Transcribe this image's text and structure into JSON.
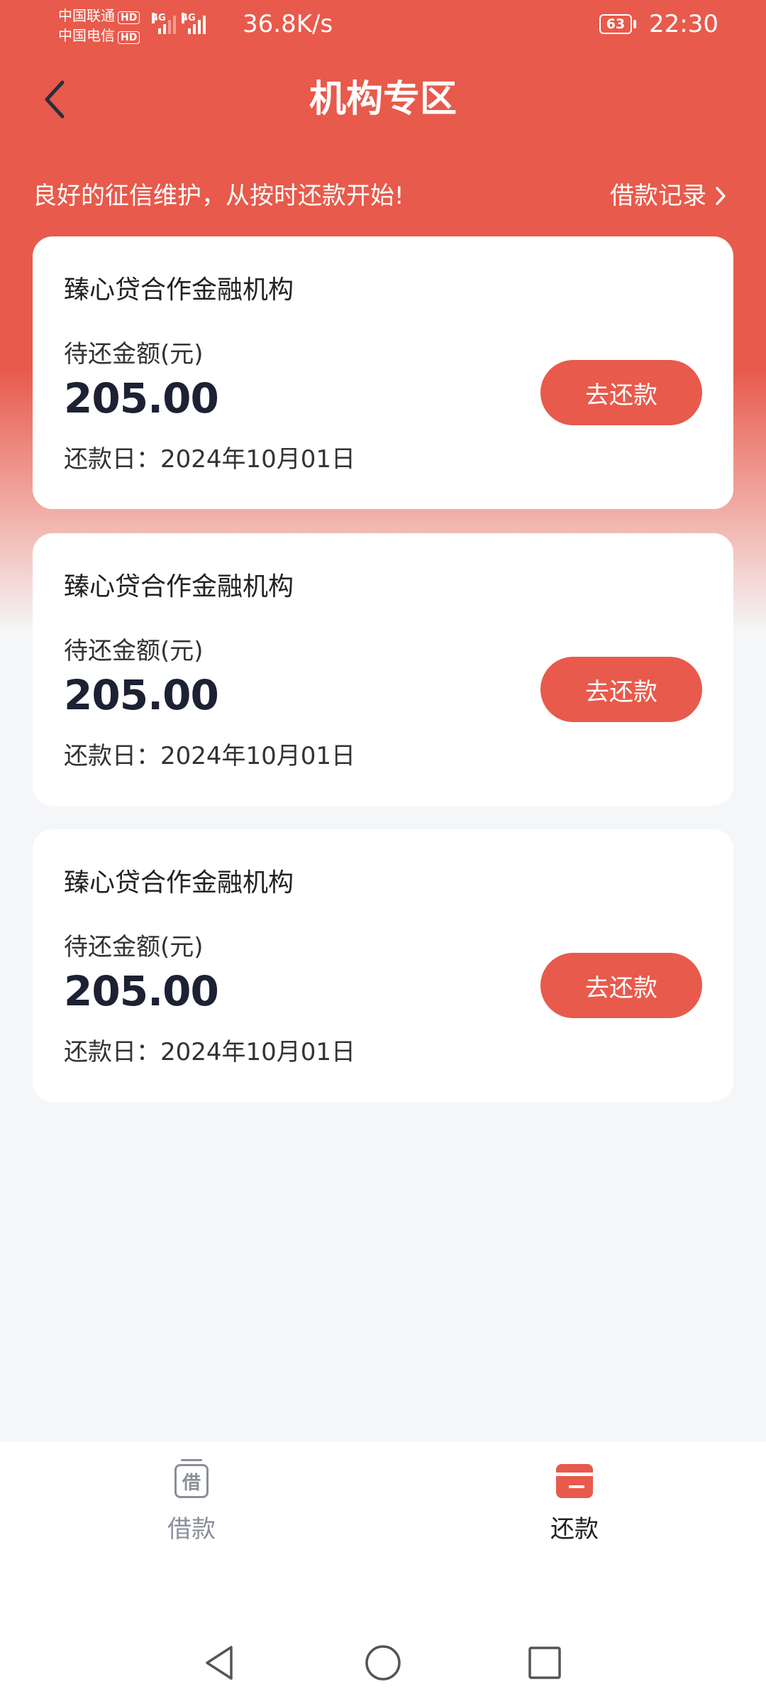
{
  "status_bar": {
    "carrier1": "中国联通",
    "carrier2": "中国电信",
    "hd": "HD",
    "net1": "4G",
    "net2": "4G",
    "speed": "36.8K/s",
    "battery": "63",
    "time": "22:30"
  },
  "header": {
    "back_icon": "chevron-left-icon",
    "title": "机构专区"
  },
  "banner": {
    "slogan": "良好的征信维护，从按时还款开始!",
    "records_label": "借款记录",
    "records_icon": "chevron-right-icon"
  },
  "loans": [
    {
      "institution": "臻心贷合作金融机构",
      "amount_label": "待还金额(元)",
      "amount": "205.00",
      "due_label": "还款日：",
      "due_date": "2024年10月01日",
      "button": "去还款"
    },
    {
      "institution": "臻心贷合作金融机构",
      "amount_label": "待还金额(元)",
      "amount": "205.00",
      "due_label": "还款日：",
      "due_date": "2024年10月01日",
      "button": "去还款"
    },
    {
      "institution": "臻心贷合作金融机构",
      "amount_label": "待还金额(元)",
      "amount": "205.00",
      "due_label": "还款日：",
      "due_date": "2024年10月01日",
      "button": "去还款"
    }
  ],
  "tabbar": {
    "borrow_icon_char": "借",
    "borrow_label": "借款",
    "repay_label": "还款",
    "active": "repay"
  },
  "colors": {
    "brand": "#e85a4b",
    "page_bg": "#f5f6f8",
    "amount_text": "#1c2233",
    "inactive_tab": "#8a8f99"
  },
  "nav": {
    "back": "nav-back-icon",
    "home": "nav-home-icon",
    "recents": "nav-recents-icon"
  }
}
